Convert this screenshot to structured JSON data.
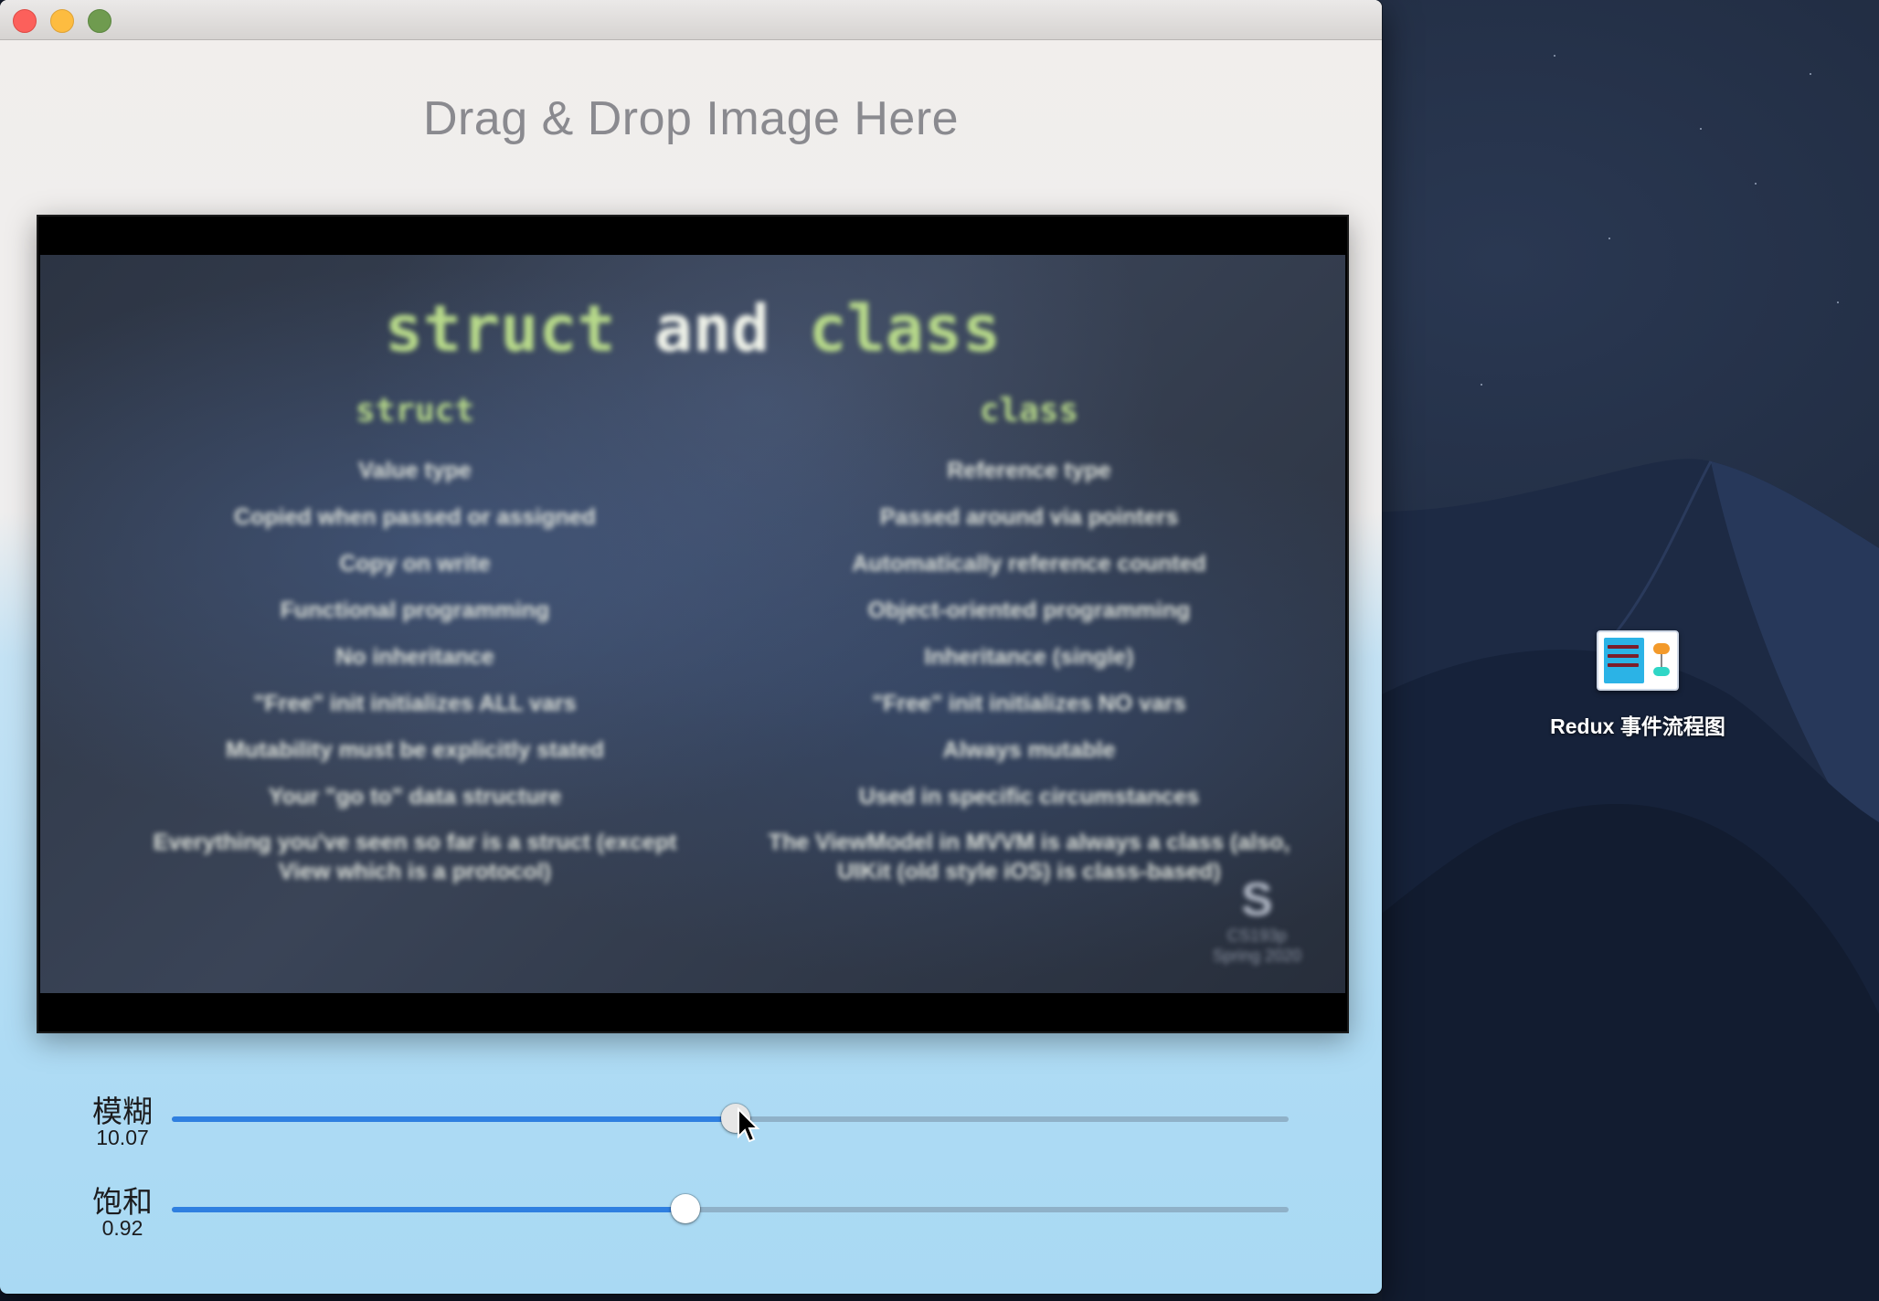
{
  "window": {
    "title": "",
    "drop_hint": "Drag & Drop Image Here"
  },
  "image": {
    "slide_title_kw1": "struct",
    "slide_title_mid": " and ",
    "slide_title_kw2": "class",
    "left_heading": "struct",
    "right_heading": "class",
    "left_items": [
      "Value type",
      "Copied when passed or assigned",
      "Copy on write",
      "Functional programming",
      "No inheritance",
      "\"Free\" init initializes ALL vars",
      "Mutability must be explicitly stated",
      "Your \"go to\" data structure",
      "Everything you've seen so far is a struct (except View which is a protocol)"
    ],
    "right_items": [
      "Reference type",
      "Passed around via pointers",
      "Automatically reference counted",
      "Object-oriented programming",
      "Inheritance (single)",
      "\"Free\" init initializes NO vars",
      "Always mutable",
      "Used in specific circumstances",
      "The ViewModel in MVVM is always a class (also, UIKit (old style iOS) is class-based)"
    ],
    "corner_big": "S",
    "corner_line1": "CS193p",
    "corner_line2": "Spring 2020"
  },
  "sliders": [
    {
      "label": "模糊",
      "value": "10.07",
      "level": 0.505
    },
    {
      "label": "饱和",
      "value": "0.92",
      "level": 0.46
    }
  ],
  "desktop": {
    "icon_label": "Redux 事件流程图",
    "icon_name": "diagram-file-icon"
  },
  "colors": {
    "accent": "#2f7fe0",
    "close": "#fc605b",
    "minimize": "#fdbc40",
    "zoom": "#6f9b4f"
  }
}
